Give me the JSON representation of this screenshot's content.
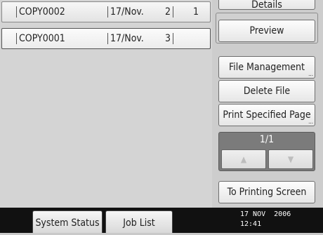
{
  "files": [
    {
      "name": "COPY0002",
      "date": "17/Nov.",
      "pages": "2",
      "copies": "1"
    },
    {
      "name": "COPY0001",
      "date": "17/Nov.",
      "pages": "3",
      "copies": ""
    }
  ],
  "sidebar": {
    "details_label": "Details",
    "preview_label": "Preview",
    "file_management_label": "File Management",
    "delete_file_label": "Delete File",
    "print_specified_page_label": "Print Specified Page",
    "page_indicator": "1/1",
    "up_arrow": "▲",
    "down_arrow": "▼",
    "to_printing_screen_label": "To Printing Screen"
  },
  "status_bar": {
    "system_status_label": "System Status",
    "job_list_label": "Job List",
    "date": "17 NOV  2006",
    "time": "12:41"
  }
}
